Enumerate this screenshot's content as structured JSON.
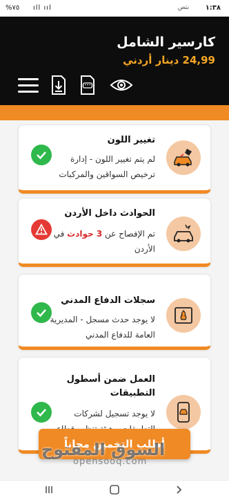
{
  "status_bar": {
    "time": "١:٣٨",
    "extra": "نتص",
    "battery": "%٧٥",
    "signal": "ıll ııl"
  },
  "header": {
    "title": "كارسير الشامل",
    "price": "24,99 دينار أردني"
  },
  "cards": [
    {
      "title": "تغيير اللون",
      "desc_lines": [
        "لم يتم تغيير اللون - إدارة",
        "ترخيص السواقين والمركبات"
      ],
      "status": "ok",
      "icon": "paint-car-icon"
    },
    {
      "title": "الحوادث داخل الأردن",
      "desc_prefix": "تم الإفصاح عن ",
      "desc_highlight": "3 حوادث",
      "desc_suffix": " في",
      "desc_line2": "الأردن",
      "status": "warn",
      "icon": "crash-car-icon"
    },
    {
      "title": "سجلات الدفاع المدني",
      "desc_lines": [
        "لا يوجد حدث مسجل - المديرية",
        "العامة للدفاع المدني"
      ],
      "status": "ok",
      "icon": "fire-car-icon"
    },
    {
      "title_lines": [
        "العمل ضمن أسطول",
        "التطبيقات"
      ],
      "desc_lines": [
        "لا يوجد تسجيل لشركات",
        "التطبيقات - هيئة تنظيم قطاع"
      ],
      "status": "ok",
      "icon": "fleet-phone-icon"
    }
  ],
  "cta": {
    "label": "أطلب التخمين مجاناً"
  },
  "watermark": {
    "main": "السوق المفتوح",
    "sub": "opensooq.com"
  },
  "colors": {
    "accent": "#f08a24",
    "header_bg": "#0d0d0d",
    "price": "#f5a623",
    "ok": "#2fb84b",
    "warn": "#e53935",
    "icon_bg": "#f4c8a2"
  }
}
